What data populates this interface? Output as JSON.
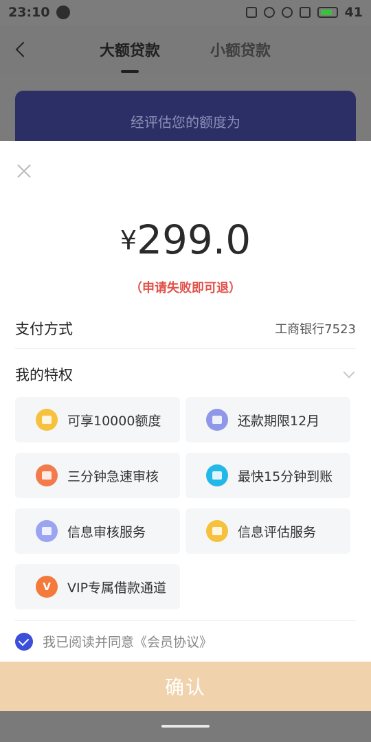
{
  "status_bar": {
    "time": "23:10",
    "battery": "41"
  },
  "nav": {
    "tab_active": "大额贷款",
    "tab_inactive": "小额贷款"
  },
  "background_card": {
    "text": "经评估您的额度为"
  },
  "sheet": {
    "amount_symbol": "¥",
    "amount": "299.0",
    "refund_note": "（申请失败即可退）",
    "payment": {
      "label": "支付方式",
      "value": "工商银行7523"
    },
    "privileges": {
      "label": "我的特权",
      "items": [
        {
          "text": "可享10000额度",
          "icon": "money-bag-icon",
          "color": "#f6c23e"
        },
        {
          "text": "还款期限12月",
          "icon": "card-clock-icon",
          "color": "#8e97e8"
        },
        {
          "text": "三分钟急速审核",
          "icon": "document-review-icon",
          "color": "#f37a4b"
        },
        {
          "text": "最快15分钟到账",
          "icon": "atm-yen-icon",
          "color": "#22b8e8"
        },
        {
          "text": "信息审核服务",
          "icon": "info-card-icon",
          "color": "#9aa4f0"
        },
        {
          "text": "信息评估服务",
          "icon": "evaluate-doc-icon",
          "color": "#f6c23e"
        },
        {
          "text": "VIP专属借款通道",
          "icon": "vip-v-icon",
          "color": "#f37a3c",
          "glyph": "V"
        }
      ]
    },
    "agreement": {
      "text": "我已阅读并同意《会员协议》",
      "checked": true
    },
    "confirm_label": "确认"
  }
}
